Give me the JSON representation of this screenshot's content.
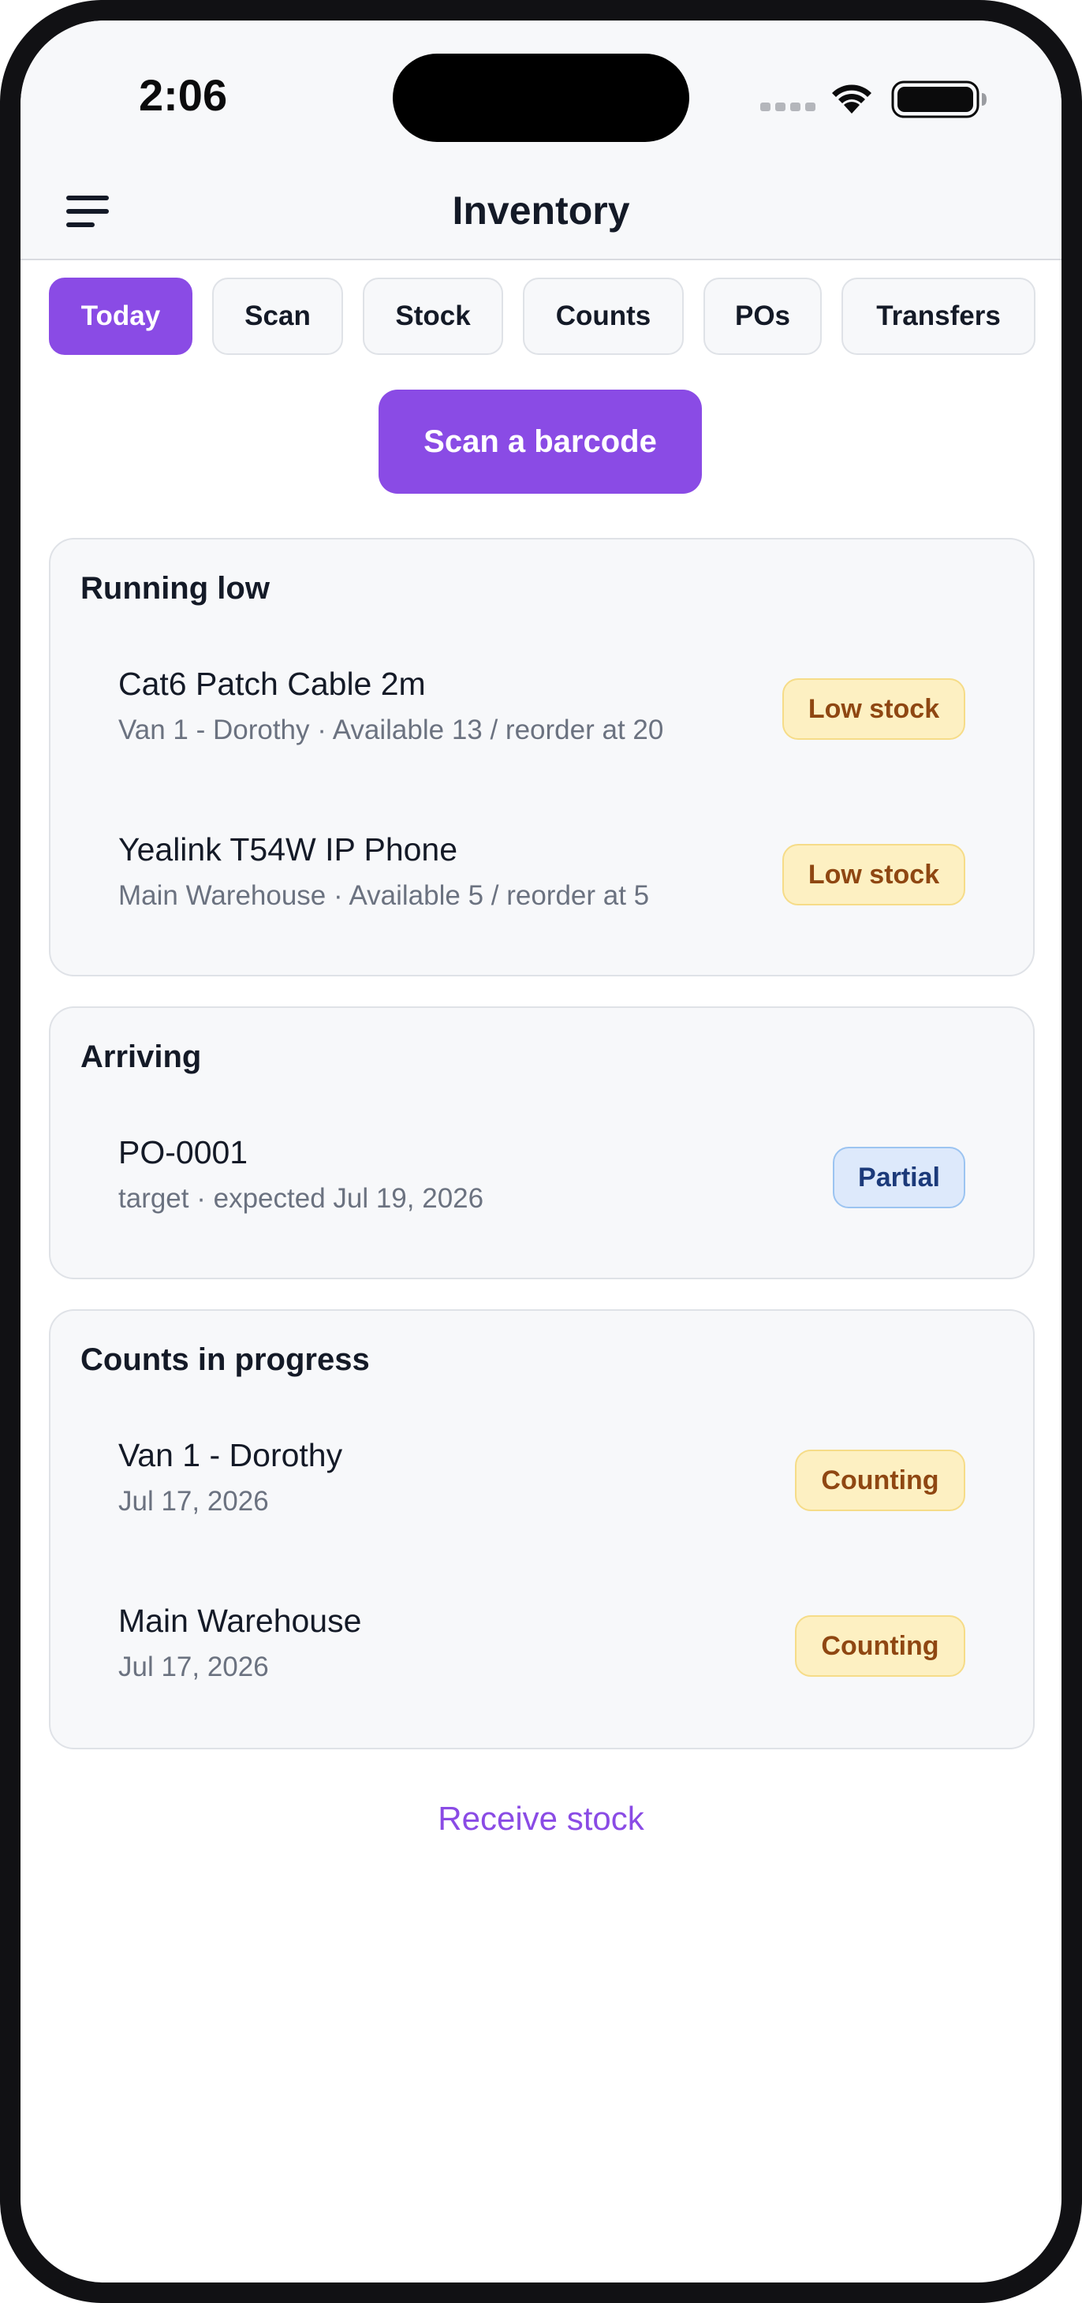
{
  "status_bar": {
    "time": "2:06",
    "icons": [
      "cellular-signal-icon",
      "wifi-icon",
      "battery-icon"
    ]
  },
  "header": {
    "title": "Inventory",
    "menu_icon": "hamburger-menu-icon"
  },
  "tabs": [
    {
      "label": "Today",
      "active": true
    },
    {
      "label": "Scan",
      "active": false
    },
    {
      "label": "Stock",
      "active": false
    },
    {
      "label": "Counts",
      "active": false
    },
    {
      "label": "POs",
      "active": false
    },
    {
      "label": "Transfers",
      "active": false
    }
  ],
  "primary_action": {
    "label": "Scan a barcode"
  },
  "sections": {
    "running_low": {
      "title": "Running low",
      "items": [
        {
          "title": "Cat6 Patch Cable 2m",
          "subtitle": "Van 1 - Dorothy · Available 13 / reorder at 20",
          "badge": "Low stock"
        },
        {
          "title": "Yealink T54W IP Phone",
          "subtitle": "Main Warehouse · Available 5 / reorder at 5",
          "badge": "Low stock"
        }
      ]
    },
    "arriving": {
      "title": "Arriving",
      "items": [
        {
          "title": "PO-0001",
          "subtitle": "target · expected Jul 19, 2026",
          "badge": "Partial"
        }
      ]
    },
    "counts_in_progress": {
      "title": "Counts in progress",
      "items": [
        {
          "title": "Van 1 - Dorothy",
          "subtitle": "Jul 17, 2026",
          "badge": "Counting"
        },
        {
          "title": "Main Warehouse",
          "subtitle": "Jul 17, 2026",
          "badge": "Counting"
        }
      ]
    }
  },
  "footer_link": {
    "label": "Receive stock"
  },
  "colors": {
    "accent": "#8a4be5",
    "warning_badge_bg": "#fdf0c2",
    "warning_badge_text": "#8f4712",
    "info_badge_bg": "#dde9fb",
    "info_badge_text": "#1c3a7a",
    "card_bg": "#f7f8fa",
    "text_primary": "#141a27",
    "text_secondary": "#6b7280"
  }
}
